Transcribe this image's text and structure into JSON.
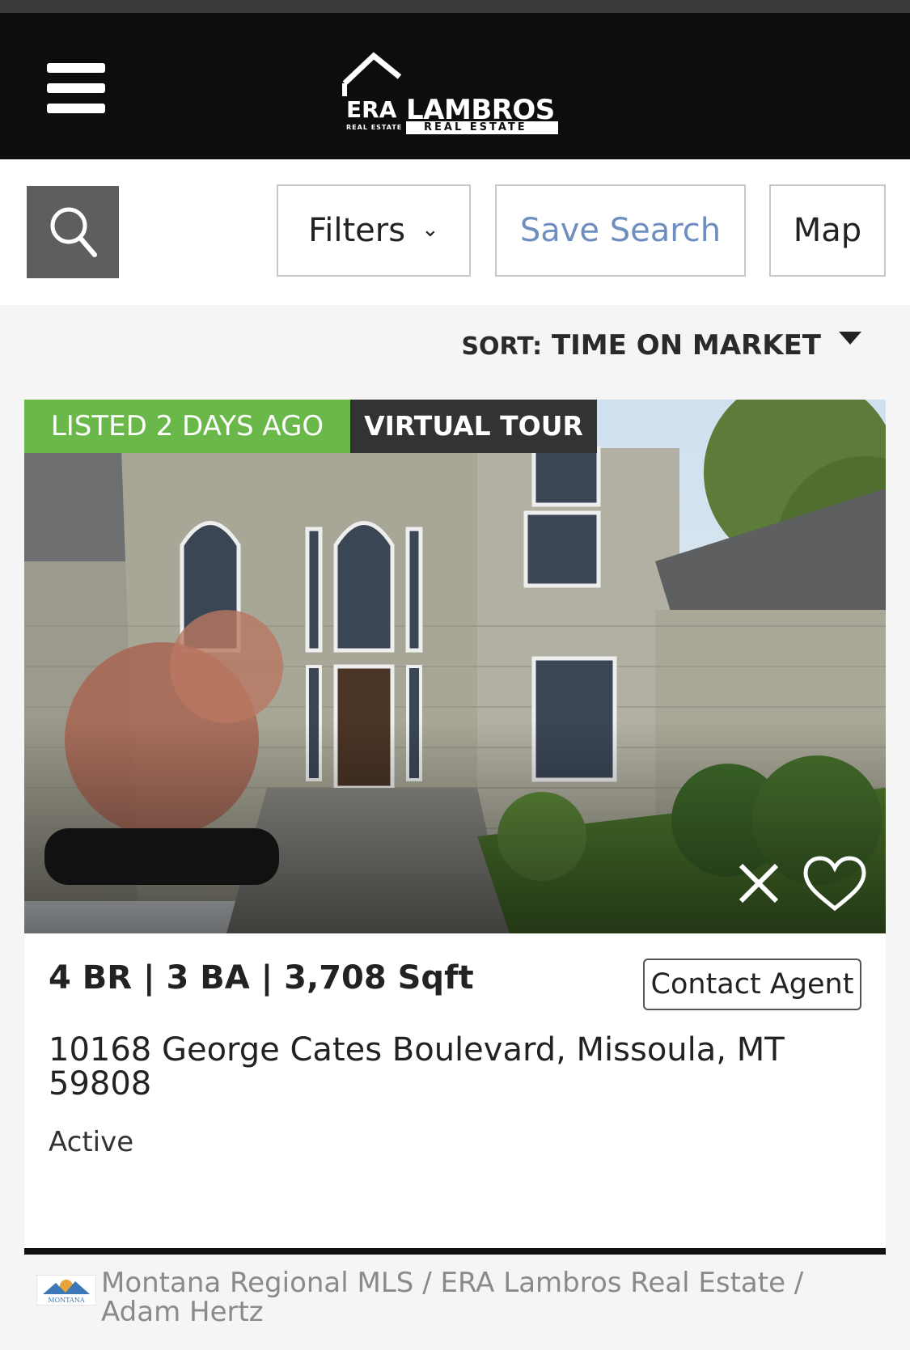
{
  "header": {
    "logo": {
      "era": "ERA",
      "era_sub": "REAL ESTATE",
      "name": "LAMBROS",
      "sub": "REAL ESTATE"
    }
  },
  "toolbar": {
    "filters_label": "Filters",
    "save_search_label": "Save Search",
    "map_label": "Map"
  },
  "sort": {
    "label": "SORT:",
    "value": "TIME ON MARKET"
  },
  "listing": {
    "badge_listed": "LISTED 2 DAYS AGO",
    "badge_tour": "VIRTUAL TOUR",
    "specs": "4 BR | 3 BA | 3,708 Sqft",
    "contact_label": "Contact Agent",
    "address": "10168 George Cates Boulevard, Missoula, MT 59808",
    "status": "Active",
    "colors": {
      "listed_badge": "#6bb84a",
      "tour_badge": "#333333"
    }
  },
  "attribution": {
    "logo_text": "MONTANA",
    "text": "Montana Regional MLS / ERA Lambros Real Estate / Adam Hertz"
  },
  "icons": [
    "menu-icon",
    "search-icon",
    "chevron-down-icon",
    "caret-down-icon",
    "close-icon",
    "heart-icon"
  ]
}
